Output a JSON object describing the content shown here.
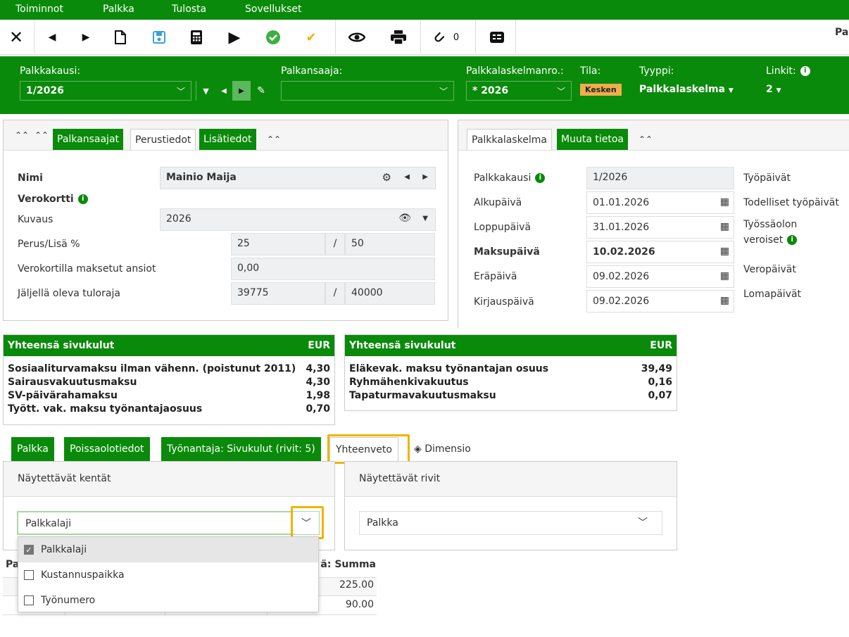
{
  "menu": [
    "Toiminnot",
    "Palkka",
    "Tulosta",
    "Sovellukset"
  ],
  "toolbar": {
    "attachments_count": "0",
    "right_text": "Pal"
  },
  "header": {
    "period_label": "Palkkakausi:",
    "period_value": "1/2026",
    "employee_label": "Palkansaaja:",
    "employee_value": "",
    "calcno_label": "Palkkalaskelmanro.:",
    "calcno_value": "* 2026",
    "status_label": "Tila:",
    "status_value": "Kesken",
    "type_label": "Tyyppi:",
    "type_value": "Palkkalaskelma",
    "links_label": "Linkit:",
    "links_value": "2"
  },
  "left_panel": {
    "tabs": [
      "Palkansaajat",
      "Perustiedot",
      "Lisätiedot"
    ],
    "name_label": "Nimi",
    "name_value": "Mainio Maija",
    "taxcard_label": "Verokortti",
    "desc_label": "Kuvaus",
    "desc_value": "2026",
    "rate_label": "Perus/Lisä %",
    "rate_base": "25",
    "rate_extra": "50",
    "paid_label": "Verokortilla maksetut ansiot",
    "paid_value": "0,00",
    "limit_label": "Jäljellä oleva tuloraja",
    "limit_remaining": "39775",
    "limit_total": "40000",
    "slash": "/"
  },
  "right_panel": {
    "tabs": [
      "Palkkalaskelma",
      "Muuta tietoa"
    ],
    "period_label": "Palkkakausi",
    "period_value": "1/2026",
    "start_label": "Alkupäivä",
    "start_value": "01.01.2026",
    "end_label": "Loppupäivä",
    "end_value": "31.01.2026",
    "pay_label": "Maksupäivä",
    "pay_value": "10.02.2026",
    "due_label": "Eräpäivä",
    "due_value": "09.02.2026",
    "booking_label": "Kirjauspäivä",
    "booking_value": "09.02.2026",
    "side_labels": [
      "Työpäivät",
      "Todelliset työpäivät",
      "Työssäolon",
      "veroiset",
      "Veropäivät",
      "Lomapäivät"
    ]
  },
  "summary_left": {
    "title": "Yhteensä sivukulut",
    "currency": "EUR",
    "rows": [
      {
        "label": "Sosiaaliturvamaksu ilman vähenn. (poistunut 2011)",
        "value": "4,30"
      },
      {
        "label": "Sairausvakuutusmaksu",
        "value": "4,30"
      },
      {
        "label": "SV-päivärahamaksu",
        "value": "1,98"
      },
      {
        "label": "Tyött. vak. maksu työnantajaosuus",
        "value": "0,70"
      }
    ]
  },
  "summary_right": {
    "title": "Yhteensä sivukulut",
    "currency": "EUR",
    "rows": [
      {
        "label": "Eläkevak. maksu työnantajan osuus",
        "value": "39,49"
      },
      {
        "label": "Ryhmähenkivakuutus",
        "value": "0,16"
      },
      {
        "label": "Tapaturmavakuutusmaksu",
        "value": "0,07"
      }
    ]
  },
  "bottom_tabs": [
    "Palkka",
    "Poissaolotiedot",
    "Työnantaja: Sivukulut (rivit: 5)",
    "Yhteenveto",
    "Dimensio"
  ],
  "fields_panel": {
    "title": "Näytettävät kentät",
    "selected": "Palkkalaji"
  },
  "rows_panel": {
    "title": "Näytettävät rivit",
    "selected": "Palkka"
  },
  "dropdown_options": [
    {
      "label": "Palkkalaji",
      "checked": true
    },
    {
      "label": "Kustannuspaikka",
      "checked": false
    },
    {
      "label": "Työnumero",
      "checked": false
    }
  ],
  "grid": {
    "header_left": "Pa",
    "header_right": "ä: Summa",
    "values": [
      "225.00",
      "90.00"
    ]
  }
}
